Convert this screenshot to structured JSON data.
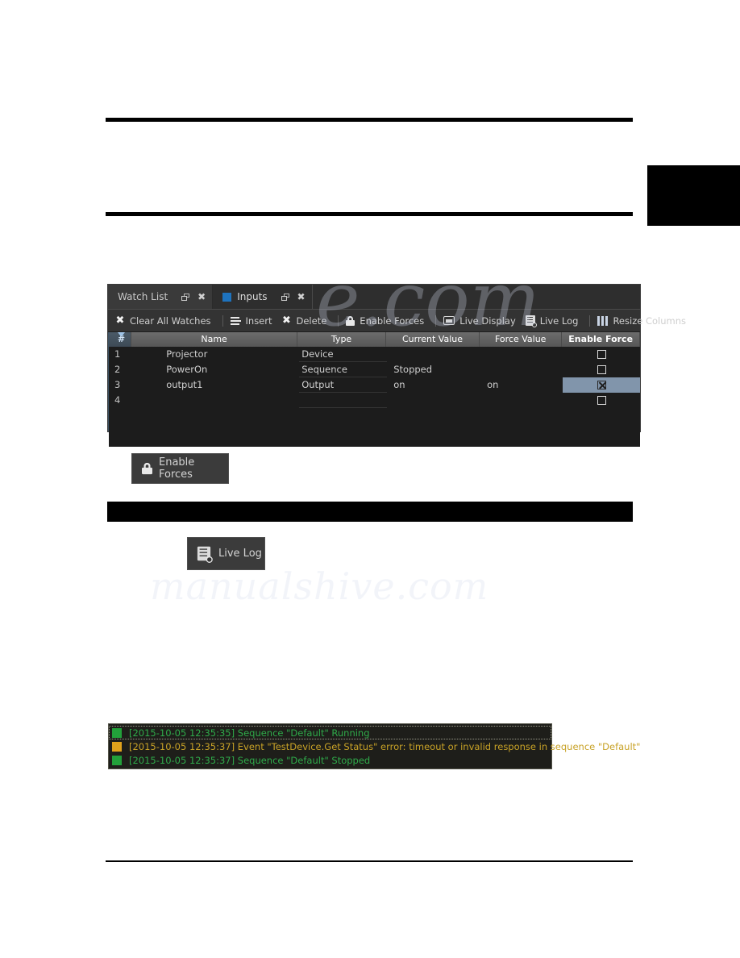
{
  "page": {
    "rules": [
      "top-rule",
      "second-rule",
      "bottom-rule"
    ],
    "black_block_label": "",
    "black_band_label": ""
  },
  "watermark": {
    "line1": "e.com",
    "line2": "manualshive.com"
  },
  "panel": {
    "tabs": [
      {
        "label": "Watch List",
        "active": false,
        "icon": null,
        "restore_icon": "restore-icon",
        "close_icon": "close-icon"
      },
      {
        "label": "Inputs",
        "active": true,
        "icon": "blue-square-icon",
        "restore_icon": "restore-icon",
        "close_icon": "close-icon"
      }
    ],
    "toolbar": [
      {
        "label": "Clear All Watches",
        "icon": "x-icon",
        "sep_after": true
      },
      {
        "label": "Insert",
        "icon": "insert-rows-icon",
        "sep_after": false
      },
      {
        "label": "Delete",
        "icon": "x-icon",
        "sep_after": true
      },
      {
        "label": "Enable Forces",
        "icon": "lock-icon",
        "sep_after": true
      },
      {
        "label": "Live Display",
        "icon": "display-icon",
        "sep_after": false
      },
      {
        "label": "Live Log",
        "icon": "log-icon",
        "sep_after": true
      },
      {
        "label": "Resize Columns",
        "icon": "columns-icon",
        "sep_after": false
      }
    ],
    "table": {
      "columns": [
        "#",
        "Name",
        "Type",
        "Current Value",
        "Force Value",
        "Enable Force"
      ],
      "sort_indicator": "#",
      "rows": [
        {
          "num": "1",
          "name": "Projector",
          "type": "Device",
          "current": "",
          "force": "",
          "enable_force": false,
          "selected": false
        },
        {
          "num": "2",
          "name": "PowerOn",
          "type": "Sequence",
          "current": "Stopped",
          "force": "",
          "enable_force": false,
          "selected": false
        },
        {
          "num": "3",
          "name": "output1",
          "type": "Output",
          "current": "on",
          "force": "on",
          "enable_force": true,
          "selected": true
        },
        {
          "num": "4",
          "name": "",
          "type": "",
          "current": "",
          "force": "",
          "enable_force": false,
          "selected": false
        }
      ]
    }
  },
  "buttons": {
    "enable_forces": {
      "label": "Enable Forces",
      "icon": "lock-icon"
    },
    "live_log": {
      "label": "Live Log",
      "icon": "log-icon"
    }
  },
  "log": {
    "entries": [
      {
        "status_color": "#22a03a",
        "severity": "ok",
        "text": "[2015-10-05 12:35:35] Sequence \"Default\" Running",
        "focused": true
      },
      {
        "status_color": "#e0a21c",
        "severity": "warning",
        "text": "[2015-10-05 12:35:37] Event \"TestDevice.Get Status\" error: timeout or invalid response in sequence \"Default\"",
        "focused": false
      },
      {
        "status_color": "#22a03a",
        "severity": "ok",
        "text": "[2015-10-05 12:35:37] Sequence \"Default\" Stopped",
        "focused": false
      }
    ]
  },
  "colors": {
    "panel_bg": "#2b2b2b",
    "toolbar_bg": "#333333",
    "grid_bg": "#1c1c1c",
    "header_grad_top": "#6c6c6c",
    "selection": "#8195ab",
    "tab_accent": "#1e73be",
    "log_bg": "#1e1e1a",
    "log_green": "#2faa4a",
    "log_orange": "#c8a227"
  }
}
